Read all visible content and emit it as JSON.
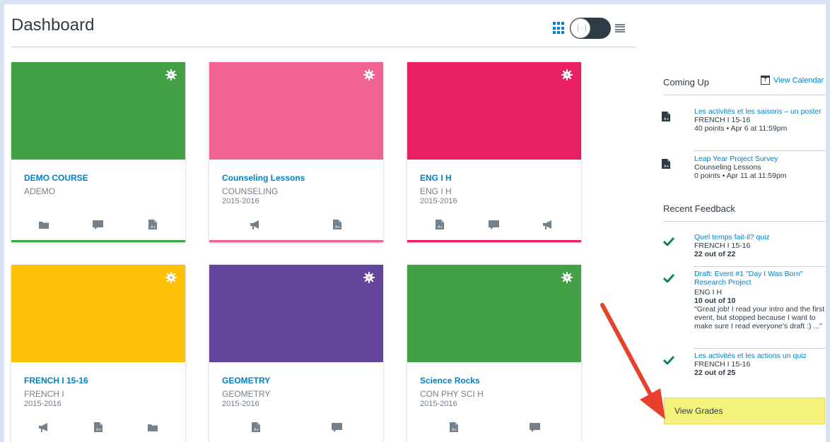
{
  "header": {
    "title": "Dashboard",
    "view_mode": "card"
  },
  "cards": [
    {
      "name": "DEMO COURSE",
      "code": "ADEMO",
      "term": "",
      "color": "#43a047",
      "icons": [
        "folder-icon",
        "discussion-icon",
        "assignment-icon"
      ]
    },
    {
      "name": "Counseling Lessons",
      "code": "COUNSELING",
      "term": "2015-2016",
      "color": "#f06291",
      "icons": [
        "announcement-icon",
        "assignment-icon"
      ]
    },
    {
      "name": "ENG I H",
      "code": "ENG I H",
      "term": "2015-2016",
      "color": "#e91e63",
      "icons": [
        "assignment-icon",
        "discussion-icon",
        "announcement-icon"
      ]
    },
    {
      "name": "FRENCH I 15-16",
      "code": "FRENCH I",
      "term": "2015-2016",
      "color": "#ffc107",
      "icons": [
        "announcement-icon",
        "assignment-icon",
        "folder-icon"
      ]
    },
    {
      "name": "GEOMETRY",
      "code": "GEOMETRY",
      "term": "2015-2016",
      "color": "#63459b",
      "icons": [
        "assignment-icon",
        "discussion-icon"
      ]
    },
    {
      "name": "Science Rocks",
      "code": "CON PHY SCI H",
      "term": "2015-2016",
      "color": "#43a047",
      "icons": [
        "assignment-icon",
        "discussion-icon"
      ]
    }
  ],
  "sidebar": {
    "coming_up": {
      "title": "Coming Up",
      "calendar_link": "View Calendar",
      "items": [
        {
          "title": "Les activités et les saisons – un poster",
          "course": "FRENCH I 15-16",
          "details": "40 points • Apr 6 at 11:59pm"
        },
        {
          "title": "Leap Year Project Survey",
          "course": "Counseling Lessons",
          "details": "0 points • Apr 11 at 11:59pm"
        }
      ]
    },
    "recent_feedback": {
      "title": "Recent Feedback",
      "items": [
        {
          "title": "Quel temps fait-il? quiz",
          "course": "FRENCH I 15-16",
          "score": "22 out of 22",
          "comment": ""
        },
        {
          "title": "Draft: Event #1 \"Day I Was Born\" Research Project",
          "course": "ENG I H",
          "score": "10 out of 10",
          "comment": "\"Great job! I read your intro and the first event, but stopped because I want to make sure I read everyone's draft :) ...\""
        },
        {
          "title": "Les activités et les actions un quiz",
          "course": "FRENCH I 15-16",
          "score": "22 out of 25",
          "comment": ""
        }
      ]
    },
    "view_grades": "View Grades"
  },
  "colors": {
    "link": "#0081c6",
    "text": "#2d3b45",
    "muted": "#73818c",
    "check": "#0b874b",
    "highlight": "#f6f37d",
    "arrow": "#e8402a"
  }
}
